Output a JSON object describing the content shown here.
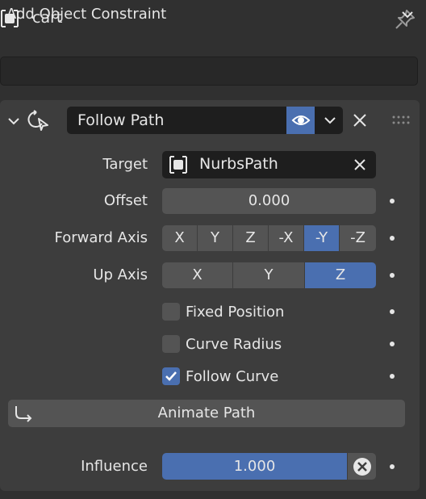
{
  "header": {
    "object_name": "cart",
    "object_icon": "object-icon",
    "pin_icon": "pin-icon"
  },
  "add_constraint": {
    "label": "Add Object Constraint",
    "icon": "chevron-down-icon"
  },
  "constraint": {
    "name": "Follow Path",
    "icon": "follow-path-icon",
    "visible": true,
    "target": {
      "label": "Target",
      "value": "NurbsPath",
      "icon": "curve-object-icon"
    },
    "offset": {
      "label": "Offset",
      "value": "0.000"
    },
    "forward_axis": {
      "label": "Forward Axis",
      "options": [
        "X",
        "Y",
        "Z",
        "-X",
        "-Y",
        "-Z"
      ],
      "selected": "-Y"
    },
    "up_axis": {
      "label": "Up Axis",
      "options": [
        "X",
        "Y",
        "Z"
      ],
      "selected": "Z"
    },
    "fixed_position": {
      "label": "Fixed Position",
      "checked": false
    },
    "curve_radius": {
      "label": "Curve Radius",
      "checked": false
    },
    "follow_curve": {
      "label": "Follow Curve",
      "checked": true
    },
    "animate_path": {
      "label": "Animate Path",
      "icon": "animate-path-icon"
    },
    "influence": {
      "label": "Influence",
      "value": "1.000",
      "level": 1.0
    }
  },
  "colors": {
    "background": "#303030",
    "panel": "#3d3d3d",
    "field_dark": "#1e1e1e",
    "field": "#545454",
    "accent": "#4a6fb0",
    "text": "#e6e6e6"
  }
}
